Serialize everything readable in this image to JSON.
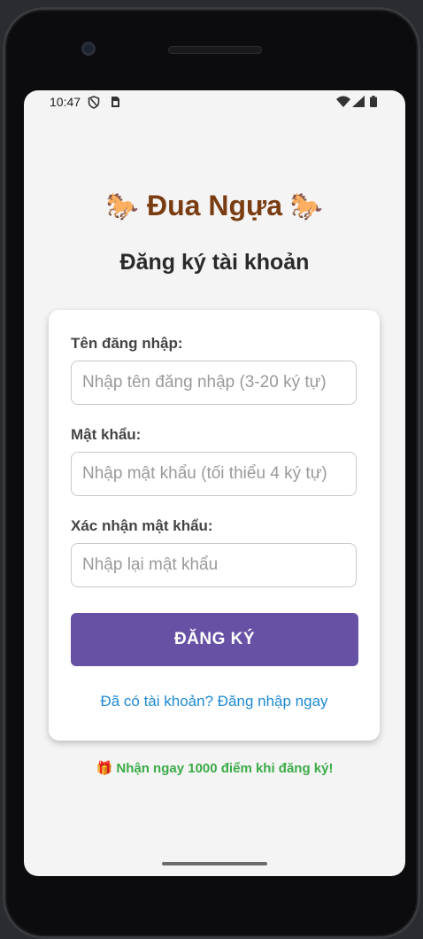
{
  "status_bar": {
    "time": "10:47"
  },
  "header": {
    "horse_emoji": "🐎",
    "app_title": "Đua Ngựa",
    "page_title": "Đăng ký tài khoản"
  },
  "form": {
    "username": {
      "label": "Tên đăng nhập:",
      "placeholder": "Nhập tên đăng nhập (3-20 ký tự)",
      "value": ""
    },
    "password": {
      "label": "Mật khẩu:",
      "placeholder": "Nhập mật khẩu (tối thiểu 4 ký tự)",
      "value": ""
    },
    "confirm_password": {
      "label": "Xác nhận mật khẩu:",
      "placeholder": "Nhập lại mật khẩu",
      "value": ""
    },
    "submit_label": "ĐĂNG KÝ",
    "login_link": "Đã có tài khoản? Đăng nhập ngay"
  },
  "promo": {
    "icon": "🎁",
    "text": "Nhận ngay 1000 điểm khi đăng ký!"
  },
  "colors": {
    "title": "#7a3d12",
    "button": "#6751a4",
    "link": "#1f8ad4",
    "promo": "#3bab46",
    "background": "#f4f4f5"
  },
  "icons": {
    "status": [
      "privacy-shield-icon",
      "sim-card-icon",
      "wifi-icon",
      "signal-icon",
      "battery-icon"
    ],
    "bottom": "home-indicator"
  }
}
